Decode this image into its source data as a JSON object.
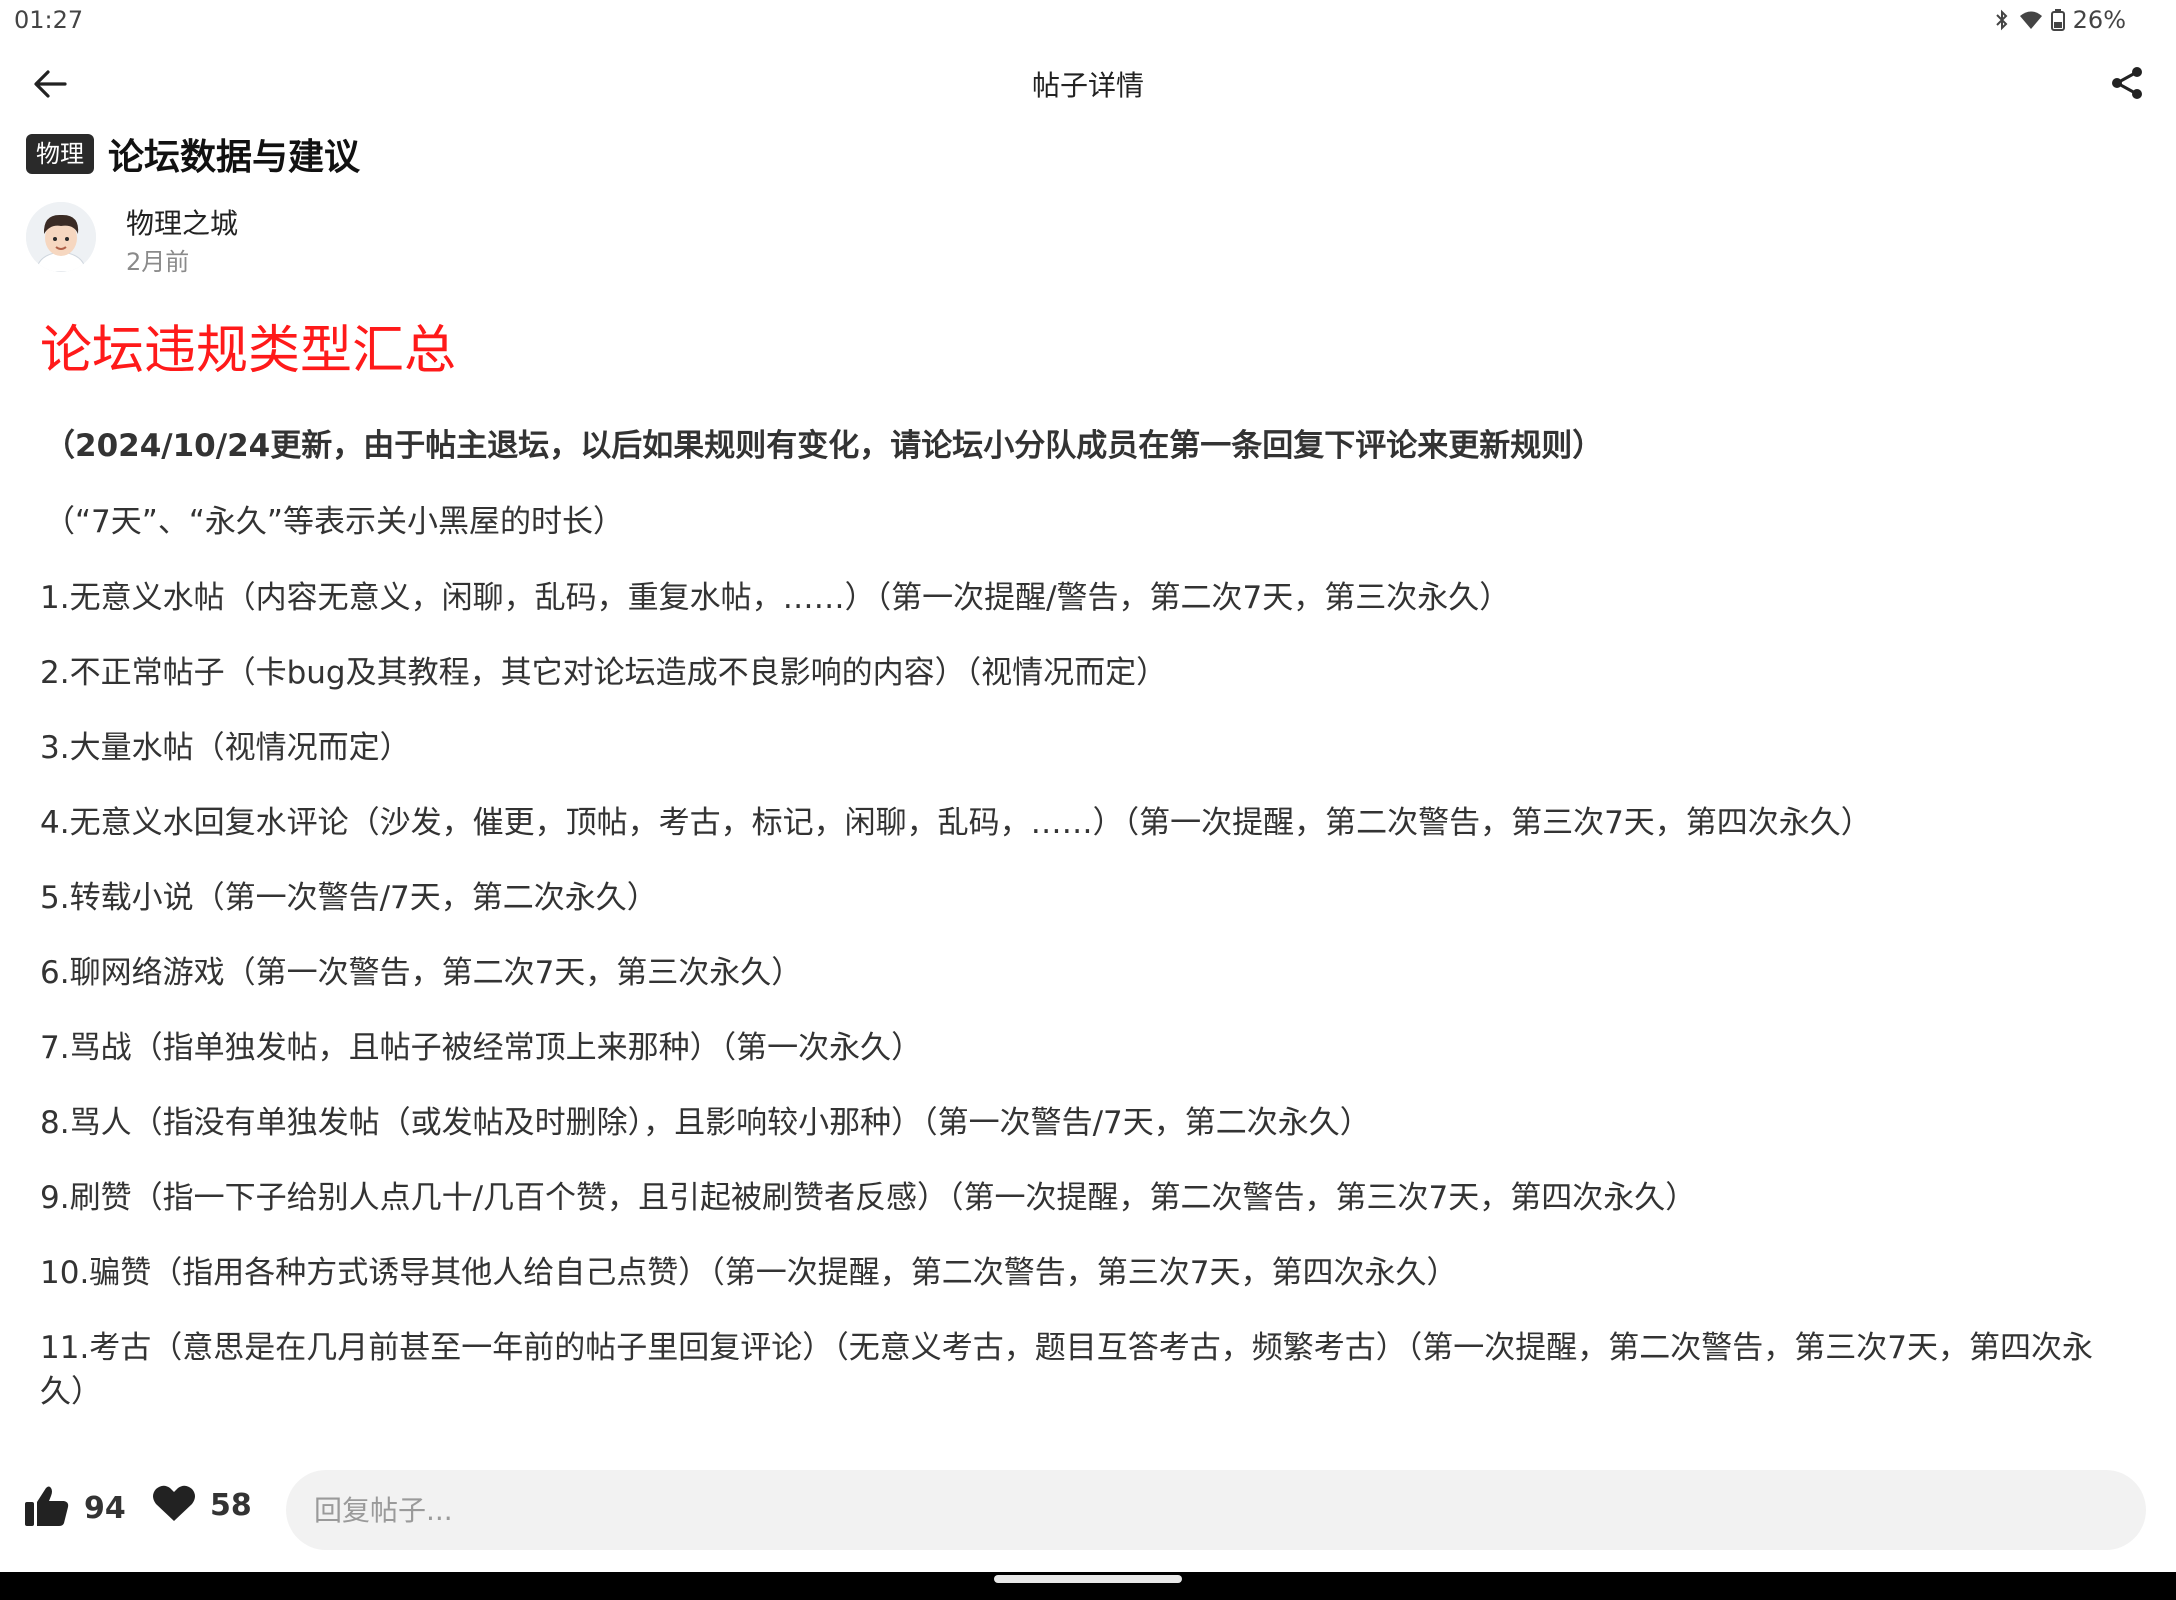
{
  "status_bar": {
    "time": "01:27",
    "battery": "26%"
  },
  "app_bar": {
    "title": "帖子详情"
  },
  "post": {
    "category": "物理",
    "title": "论坛数据与建议",
    "author": {
      "name": "物理之城",
      "time": "2月前"
    },
    "headline": "论坛违规类型汇总",
    "subhead": "（2024/10/24更新，由于帖主退坛，以后如果规则有变化，请论坛小分队成员在第一条回复下评论来更新规则）",
    "note": "（“7天”、“永久”等表示关小黑屋的时长）",
    "rules": [
      "1.无意义水帖（内容无意义，闲聊，乱码，重复水帖，……）（第一次提醒/警告，第二次7天，第三次永久）",
      "2.不正常帖子（卡bug及其教程，其它对论坛造成不良影响的内容）（视情况而定）",
      "3.大量水帖（视情况而定）",
      "4.无意义水回复水评论（沙发，催更，顶帖，考古，标记，闲聊，乱码，……）（第一次提醒，第二次警告，第三次7天，第四次永久）",
      "5.转载小说（第一次警告/7天，第二次永久）",
      "6.聊网络游戏（第一次警告，第二次7天，第三次永久）",
      "7.骂战（指单独发帖，且帖子被经常顶上来那种）（第一次永久）",
      "8.骂人（指没有单独发帖（或发帖及时删除），且影响较小那种）（第一次警告/7天，第二次永久）",
      "9.刷赞（指一下子给别人点几十/几百个赞，且引起被刷赞者反感）（第一次提醒，第二次警告，第三次7天，第四次永久）",
      "10.骗赞（指用各种方式诱导其他人给自己点赞）（第一次提醒，第二次警告，第三次7天，第四次永久）",
      "11.考古（意思是在几月前甚至一年前的帖子里回复评论）（无意义考古，题目互答考古，频繁考古）（第一次提醒，第二次警告，第三次7天，第四次永久）"
    ]
  },
  "actions": {
    "likes": "94",
    "favorites": "58",
    "reply_placeholder": "回复帖子..."
  },
  "colors": {
    "headline": "#ff1a1a",
    "tag_bg": "#2a2a2a",
    "input_bg": "#f2f2f2"
  },
  "icons": {
    "back": "arrow-left-icon",
    "share": "share-icon",
    "like": "thumbs-up-icon",
    "favorite": "heart-icon",
    "bluetooth": "bluetooth-icon",
    "wifi": "wifi-icon",
    "battery": "battery-icon"
  }
}
